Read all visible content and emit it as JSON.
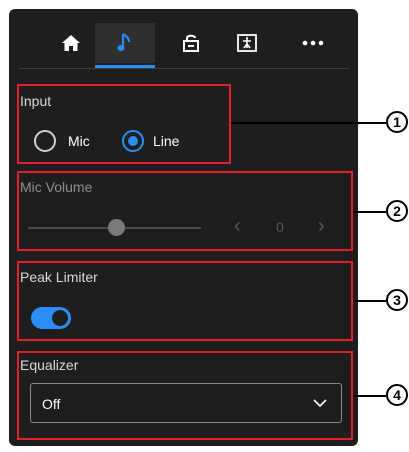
{
  "tabs": [
    {
      "icon": "home-icon",
      "active": false
    },
    {
      "icon": "music-note-icon",
      "active": true
    },
    {
      "icon": "lock-icon",
      "active": false
    },
    {
      "icon": "image-icon",
      "active": false
    },
    {
      "icon": "more-icon",
      "active": false
    }
  ],
  "input": {
    "label": "Input",
    "options": [
      {
        "label": "Mic",
        "selected": false
      },
      {
        "label": "Line",
        "selected": true
      }
    ]
  },
  "mic_volume": {
    "label": "Mic Volume",
    "value": "0",
    "prev": "‹",
    "next": "›",
    "disabled": true
  },
  "peak_limiter": {
    "label": "Peak Limiter",
    "enabled": true
  },
  "equalizer": {
    "label": "Equalizer",
    "value": "Off"
  },
  "callouts": [
    "1",
    "2",
    "3",
    "4"
  ],
  "colors": {
    "accent": "#2c8ef5",
    "highlight": "#e0202a",
    "panel": "#1e1e1e"
  }
}
